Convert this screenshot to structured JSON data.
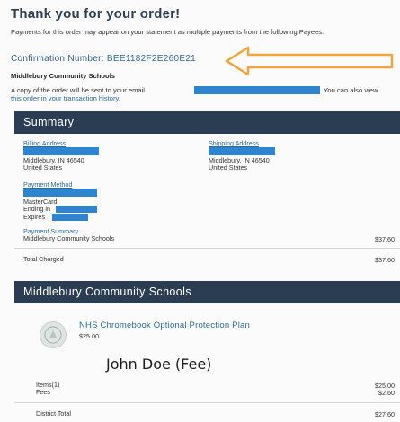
{
  "page": {
    "title": "Thank you for your order!",
    "payees_note": "Payments for this order may appear on your statement as multiple payments from the following Payees:",
    "confirmation_label": "Confirmation Number:",
    "confirmation_number": "BEE1182F2E260E21",
    "payee_name": "Middlebury Community Schools",
    "copy_note_a": "A copy of the order will be sent to your email",
    "copy_note_b": "You can also view",
    "copy_note_c": "this order in your transaction history."
  },
  "summary": {
    "header": "Summary",
    "billing_label": "Billing Address",
    "billing_city": "Middlebury, IN 46540",
    "billing_country": "United States",
    "shipping_label": "Shipping Address",
    "shipping_city": "Middlebury, IN 46540",
    "shipping_country": "United States",
    "payment_method_label": "Payment Method",
    "card_type": "MasterCard",
    "ending_in": "Ending in",
    "expires": "Expires",
    "payment_summary_label": "Payment Summary",
    "payment_summary_payee": "Middlebury Community Schools",
    "payment_summary_amount": "$37.60",
    "total_label": "Total Charged",
    "total_amount": "$37.60"
  },
  "district": {
    "header": "Middlebury Community Schools",
    "product_name": "NHS Chromebook Optional Protection Plan",
    "product_price": "$25.00",
    "student_note": "John Doe (Fee)",
    "items_label": "Items(1)",
    "items_amount": "$25.00",
    "fees_label": "Fees",
    "fees_amount": "$2.60",
    "district_total_label": "District Total",
    "district_total_amount": "$27.60"
  },
  "colors": {
    "accent": "#2f6a95",
    "header_band": "#2b3d53",
    "redaction": "#2f84cf",
    "arrow": "#f2a53a"
  },
  "icons": [
    "arrow-callout-icon",
    "school-logo-icon"
  ]
}
